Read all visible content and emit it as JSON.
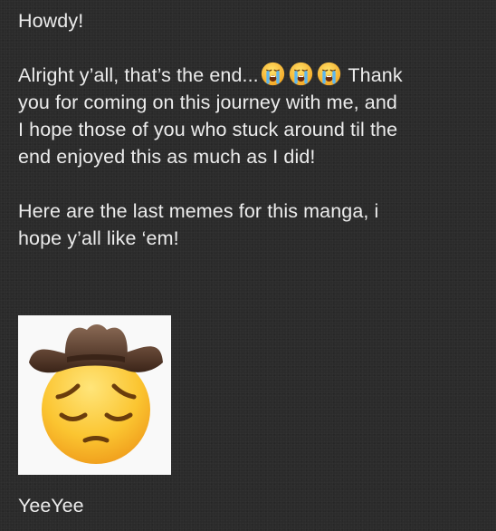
{
  "message": {
    "greeting": "Howdy!",
    "paragraph1": {
      "line1_text": "Alright y’all, that’s the end...",
      "line1_emojis": [
        "loudly-crying-face-icon",
        "loudly-crying-face-icon",
        "loudly-crying-face-icon"
      ],
      "line1_tail": " Thank",
      "line2": "you for coming on this journey with me, and",
      "line3": "I hope those of you who stuck around til the",
      "line4": "end enjoyed this as much as I did!"
    },
    "paragraph2": {
      "line1": "Here are the last memes for this manga, i",
      "line2": "hope y’all like ‘em!"
    },
    "image": {
      "icon": "cowboy-pensive-face-icon"
    },
    "signoff": "YeeYee"
  }
}
